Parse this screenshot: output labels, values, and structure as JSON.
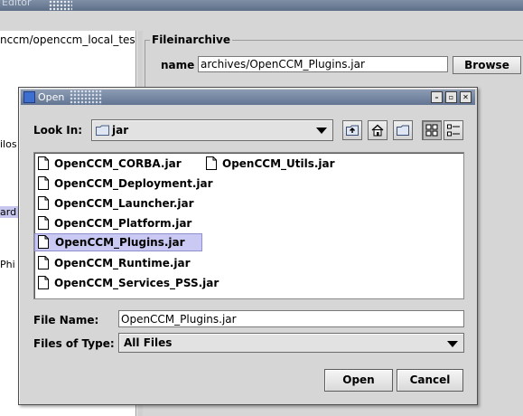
{
  "background_app": {
    "title_fragment": "Editor",
    "tree": {
      "path_text": "nccm/openccm_local_test",
      "fragments": [
        "ilos",
        "ard",
        "Phi"
      ]
    },
    "fieldset_label": "Fileinarchive",
    "name_label": "name :",
    "name_value": "archives/OpenCCM_Plugins.jar",
    "browse_label": "Browse"
  },
  "dialog": {
    "title": "Open",
    "window_buttons": {
      "minimize": "–",
      "maximize": "▫",
      "close": "✕"
    },
    "look_in_label": "Look In:",
    "look_in_value": "jar",
    "toolbar": [
      "up-one-level",
      "home",
      "new-folder",
      "list-view",
      "details-view"
    ],
    "files": [
      "OpenCCM_CORBA.jar",
      "OpenCCM_Deployment.jar",
      "OpenCCM_Launcher.jar",
      "OpenCCM_Platform.jar",
      "OpenCCM_Plugins.jar",
      "OpenCCM_Runtime.jar",
      "OpenCCM_Services_PSS.jar",
      "OpenCCM_Utils.jar"
    ],
    "selected_file": "OpenCCM_Plugins.jar",
    "file_name_label": "File Name:",
    "file_name_value": "OpenCCM_Plugins.jar",
    "file_type_label": "Files of Type:",
    "file_type_value": "All Files",
    "open_label": "Open",
    "cancel_label": "Cancel"
  },
  "colors": {
    "selection": "#c9c9f3",
    "titlebar": "#627592",
    "background": "#d6d6d6"
  }
}
